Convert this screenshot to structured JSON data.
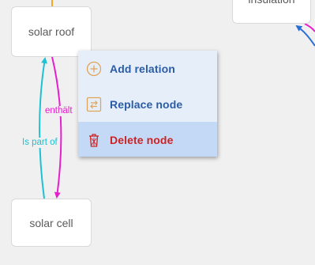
{
  "nodes": {
    "solar_roof": "solar roof",
    "solar_cell": "solar cell",
    "insulation": "insulation"
  },
  "edges": {
    "contains_label": "enthält",
    "is_part_of_label": "Is part of"
  },
  "colors": {
    "contains_edge": "#e61ecc",
    "is_part_of_edge": "#1cc1d4",
    "top_edge": "#f5a623",
    "menu_background": "#e6eff9",
    "menu_active_background": "#c3d9f6",
    "menu_text": "#2a5ca8",
    "delete_text": "#cc2222",
    "icon_orange": "#e0a55a"
  },
  "context_menu": {
    "items": [
      {
        "label": "Add relation",
        "icon": "add-circle-icon"
      },
      {
        "label": "Replace node",
        "icon": "swap-icon"
      },
      {
        "label": "Delete node",
        "icon": "trash-icon"
      }
    ]
  }
}
